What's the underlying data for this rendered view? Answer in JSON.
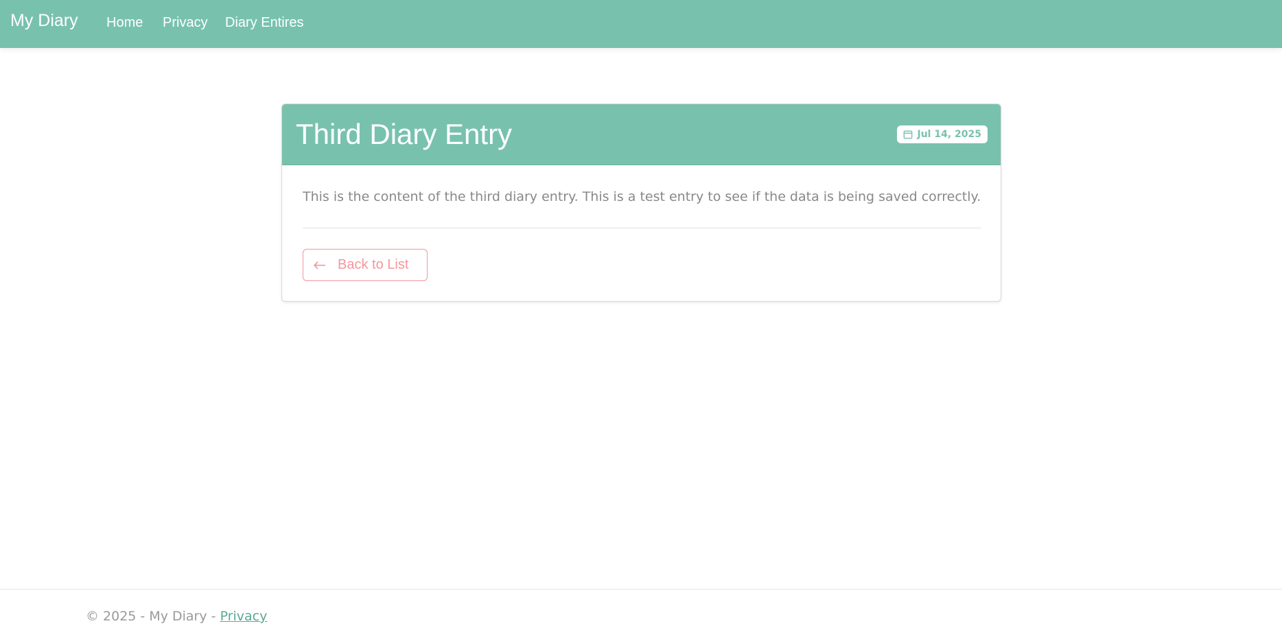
{
  "nav": {
    "brand": "My Diary",
    "links": [
      {
        "label": "Home"
      },
      {
        "label": "Privacy"
      },
      {
        "label": "Diary Entires"
      }
    ]
  },
  "entry": {
    "title": "Third Diary Entry",
    "date": "Jul 14, 2025",
    "date_icon": "calendar-icon",
    "content": "This is the content of the third diary entry. This is a test entry to see if the data is being saved correctly.",
    "back_label": "Back to List",
    "back_icon": "arrow-left-icon"
  },
  "footer": {
    "text": "© 2025 - My Diary - ",
    "link": "Privacy"
  },
  "colors": {
    "primary": "#78c2ad",
    "secondary": "#f3969a",
    "text_muted": "#888888"
  }
}
